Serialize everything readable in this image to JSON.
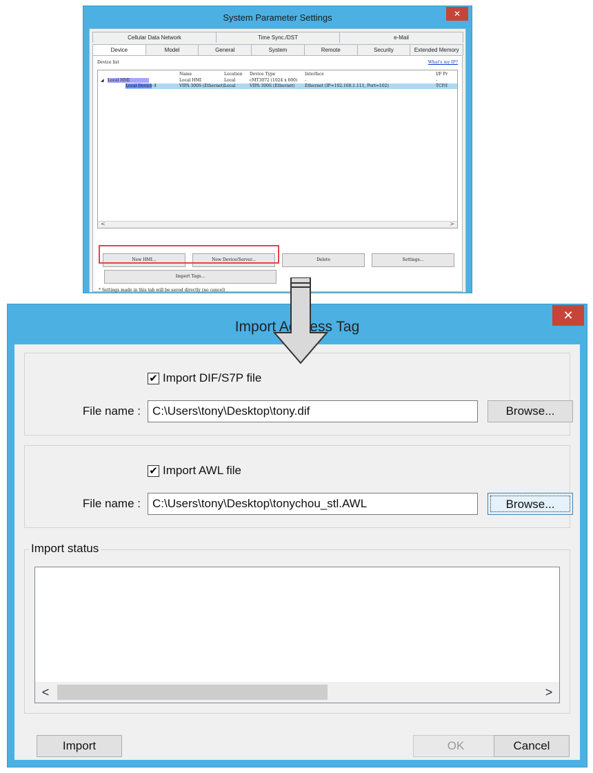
{
  "settings_window": {
    "title": "System Parameter Settings",
    "close_glyph": "✕",
    "tabs_row1": [
      "Cellular Data Network",
      "Time Sync./DST",
      "e-Mail"
    ],
    "tabs_row2": [
      "Device",
      "Model",
      "General",
      "System",
      "Remote",
      "Security",
      "Extended Memory"
    ],
    "active_tab": "Device",
    "device_list_label": "Device list",
    "whats_ip_link": "What's my IP?",
    "columns": [
      "Name",
      "Location",
      "Device Type",
      "Interface",
      "I/F Pr"
    ],
    "rows": [
      {
        "tree": "Local HMI",
        "name": "Local HMI",
        "location": "Local",
        "device_type": "cMT3072 (1024 x 600)",
        "interface": "-",
        "protocol": "-"
      },
      {
        "tree": "Local Device 4",
        "name": "VIPA 300S (Ethernet)",
        "location": "Local",
        "device_type": "VIPA 300S (Ethernet)",
        "interface": "Ethernet (IP=192.168.1.111, Port=102)",
        "protocol": "TCP/I"
      }
    ],
    "buttons": {
      "new_hmi": "New HMI...",
      "new_device": "New Device/Server...",
      "delete": "Delete",
      "settings": "Settings...",
      "import_tags": "Import Tags..."
    },
    "note": "* Settings made in this tab will be saved directly (no cancel)"
  },
  "import_dialog": {
    "title": "Import Address Tag",
    "close_glyph": "✕",
    "dif_group": {
      "checkbox_label": "Import DIF/S7P file",
      "checked": true,
      "file_label": "File name :",
      "file_value": "C:\\Users\\tony\\Desktop\\tony.dif",
      "browse": "Browse..."
    },
    "awl_group": {
      "checkbox_label": "Import AWL file",
      "checked": true,
      "file_label": "File name :",
      "file_value": "C:\\Users\\tony\\Desktop\\tonychou_stl.AWL",
      "browse": "Browse..."
    },
    "status_label": "Import status",
    "status_text": "",
    "buttons": {
      "import": "Import",
      "ok": "OK",
      "cancel": "Cancel"
    }
  },
  "icons": {
    "checkmark": "✔",
    "scroll_left": "<",
    "scroll_right": ">",
    "down_arrow": "arrow-down"
  },
  "colors": {
    "title_bar": "#4cb0e2",
    "close_button": "#c7443b",
    "highlight_box": "#e34545",
    "link": "#0a38c8"
  }
}
